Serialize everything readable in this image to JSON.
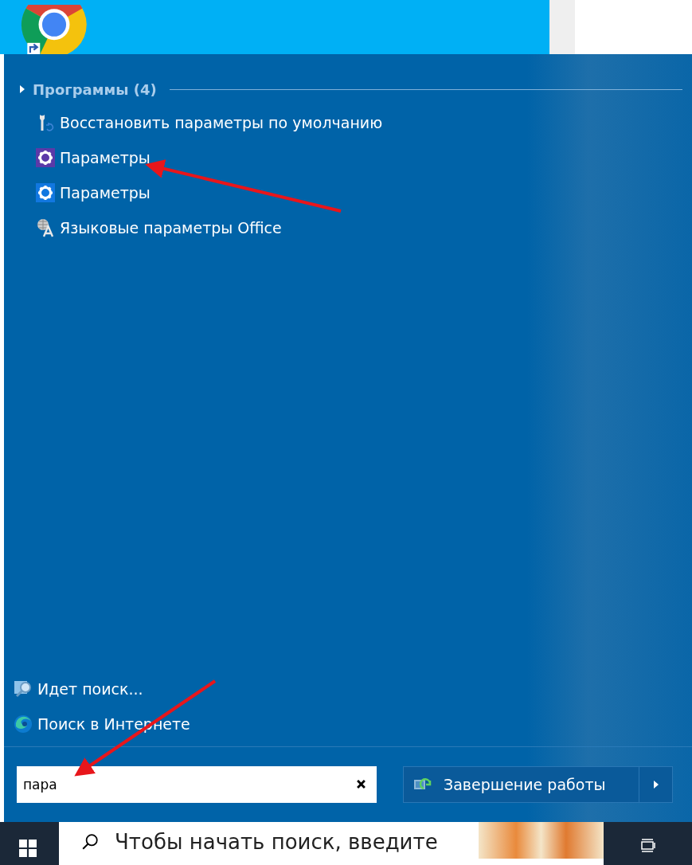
{
  "start_menu": {
    "group": {
      "label": "Программы (4)",
      "expanded": false
    },
    "results": [
      {
        "label": "Восстановить параметры по умолчанию",
        "kind": "restore"
      },
      {
        "label": "Параметры",
        "kind": "settings-purple"
      },
      {
        "label": "Параметры",
        "kind": "settings-blue"
      },
      {
        "label": "Языковые параметры Office",
        "kind": "language"
      }
    ],
    "links": [
      {
        "label": "Идет поиск...",
        "kind": "searching"
      },
      {
        "label": "Поиск в Интернете",
        "kind": "web"
      }
    ],
    "search": {
      "value": "пара"
    },
    "shutdown": {
      "label": "Завершение работы"
    }
  },
  "taskbar": {
    "search": {
      "placeholder": "Чтобы начать поиск, введите"
    }
  }
}
